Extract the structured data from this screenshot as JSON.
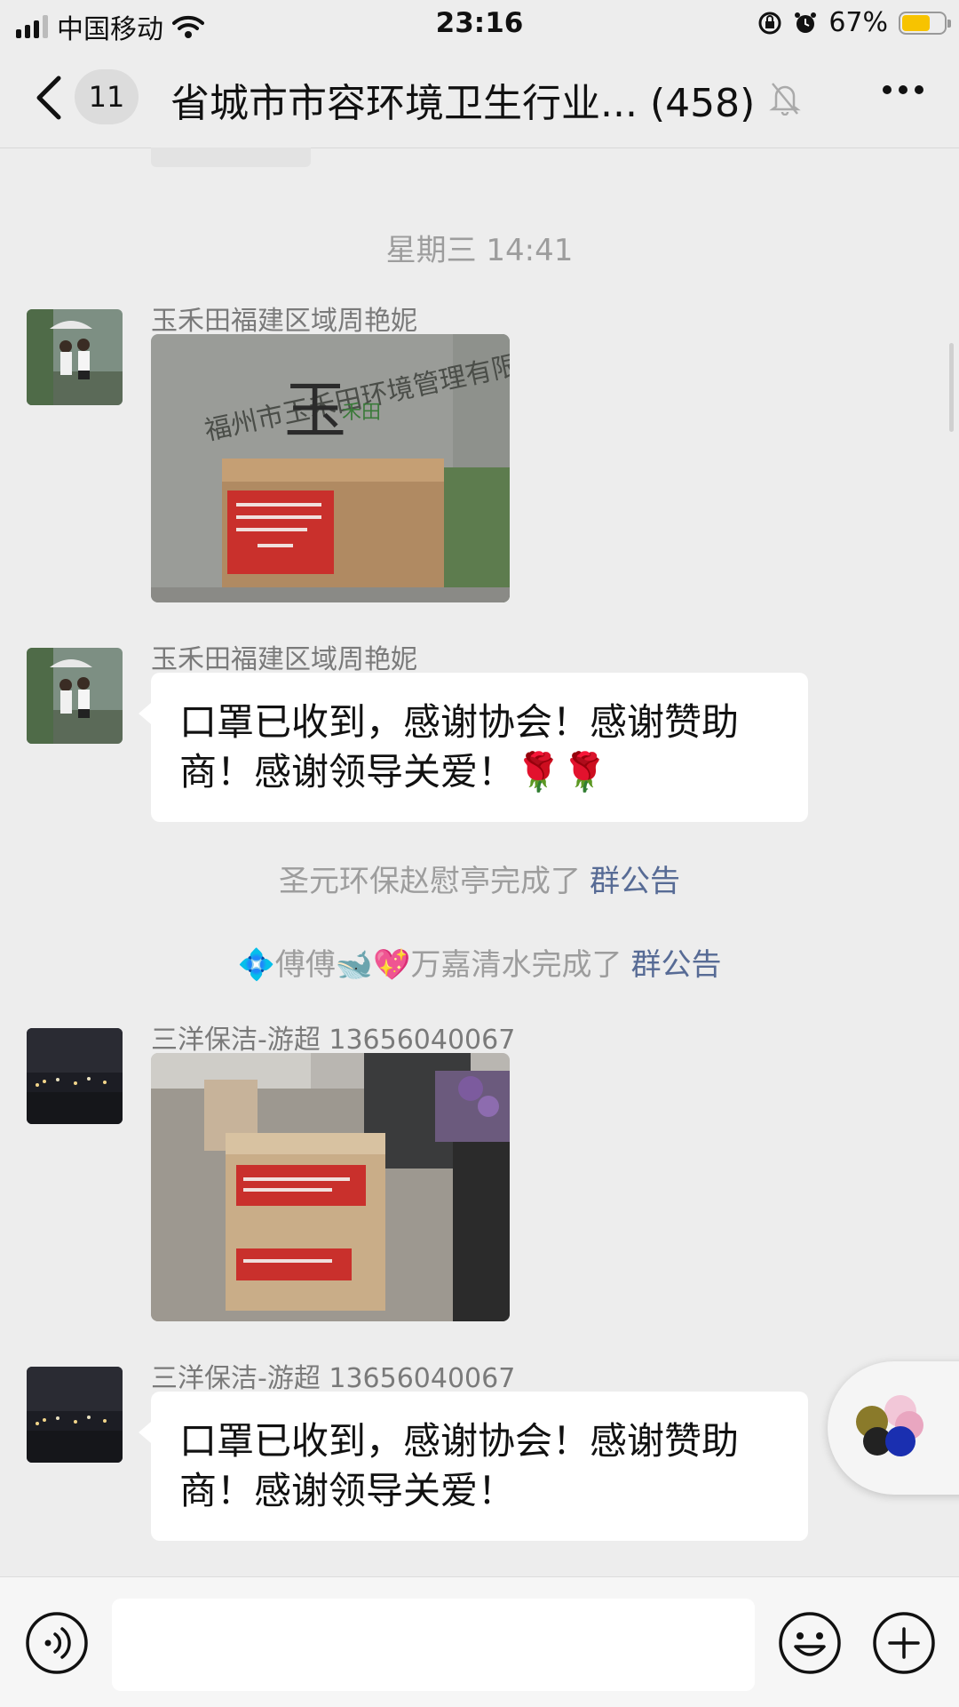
{
  "status_bar": {
    "carrier": "中国移动",
    "time": "23:16",
    "battery": "67%",
    "battery_level": 0.67
  },
  "nav": {
    "unread_count": "11",
    "title": "省城市市容环境卫生行业...",
    "member_count": "(458)"
  },
  "chat": {
    "timestamp": "星期三 14:41",
    "messages": [
      {
        "type": "image",
        "sender": "玉禾田福建区域周艳妮"
      },
      {
        "type": "text",
        "sender": "玉禾田福建区域周艳妮",
        "text": "口罩已收到，感谢协会！感谢赞助商！感谢领导关爱！🌹🌹"
      },
      {
        "type": "image",
        "sender": "三洋保洁-游超 13656040067"
      },
      {
        "type": "text",
        "sender": "三洋保洁-游超 13656040067",
        "text": "口罩已收到，感谢协会！感谢赞助商！感谢领导关爱！"
      }
    ],
    "system_notices": [
      {
        "text": "圣元环保赵慰亭完成了",
        "link": "群公告"
      },
      {
        "text": "💠傅傅🐋💖万嘉清水完成了",
        "link": "群公告"
      }
    ]
  },
  "input_bar": {
    "voice_icon": "voice-icon",
    "emoji_icon": "emoji-icon",
    "plus_icon": "plus-icon"
  }
}
